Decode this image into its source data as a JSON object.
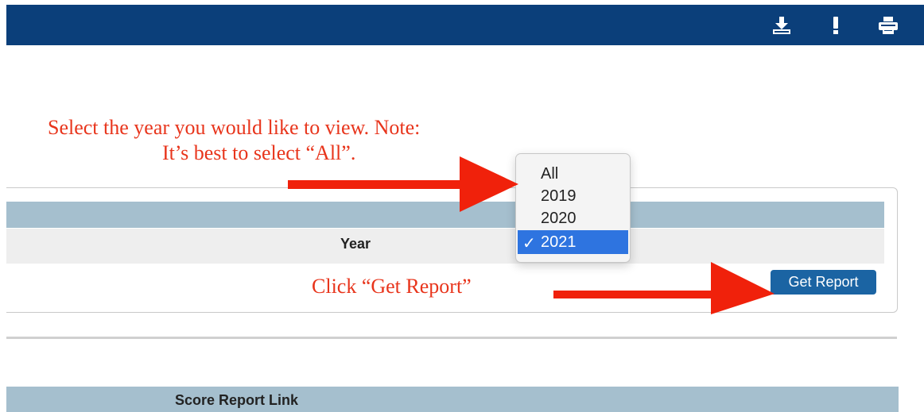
{
  "header": {
    "icons": [
      "download-icon",
      "alert-icon",
      "print-icon"
    ]
  },
  "annotations": {
    "select_note_line1": "Select the year you would like to view.  Note:",
    "select_note_line2": "It’s best to select “All”.",
    "click_note": "Click “Get Report”",
    "color": "#e8351c"
  },
  "report_panel": {
    "year_header": "Year",
    "year_select": {
      "options": [
        "All",
        "2019",
        "2020",
        "2021"
      ],
      "selected": "2021",
      "check_mark": "✓"
    },
    "get_report_label": "Get Report"
  },
  "score_table": {
    "header": "Score Report Link"
  },
  "colors": {
    "topbar": "#0b3f7a",
    "table_header": "#a5bfce",
    "button": "#1b64a3",
    "selected_option": "#2e74e0"
  }
}
